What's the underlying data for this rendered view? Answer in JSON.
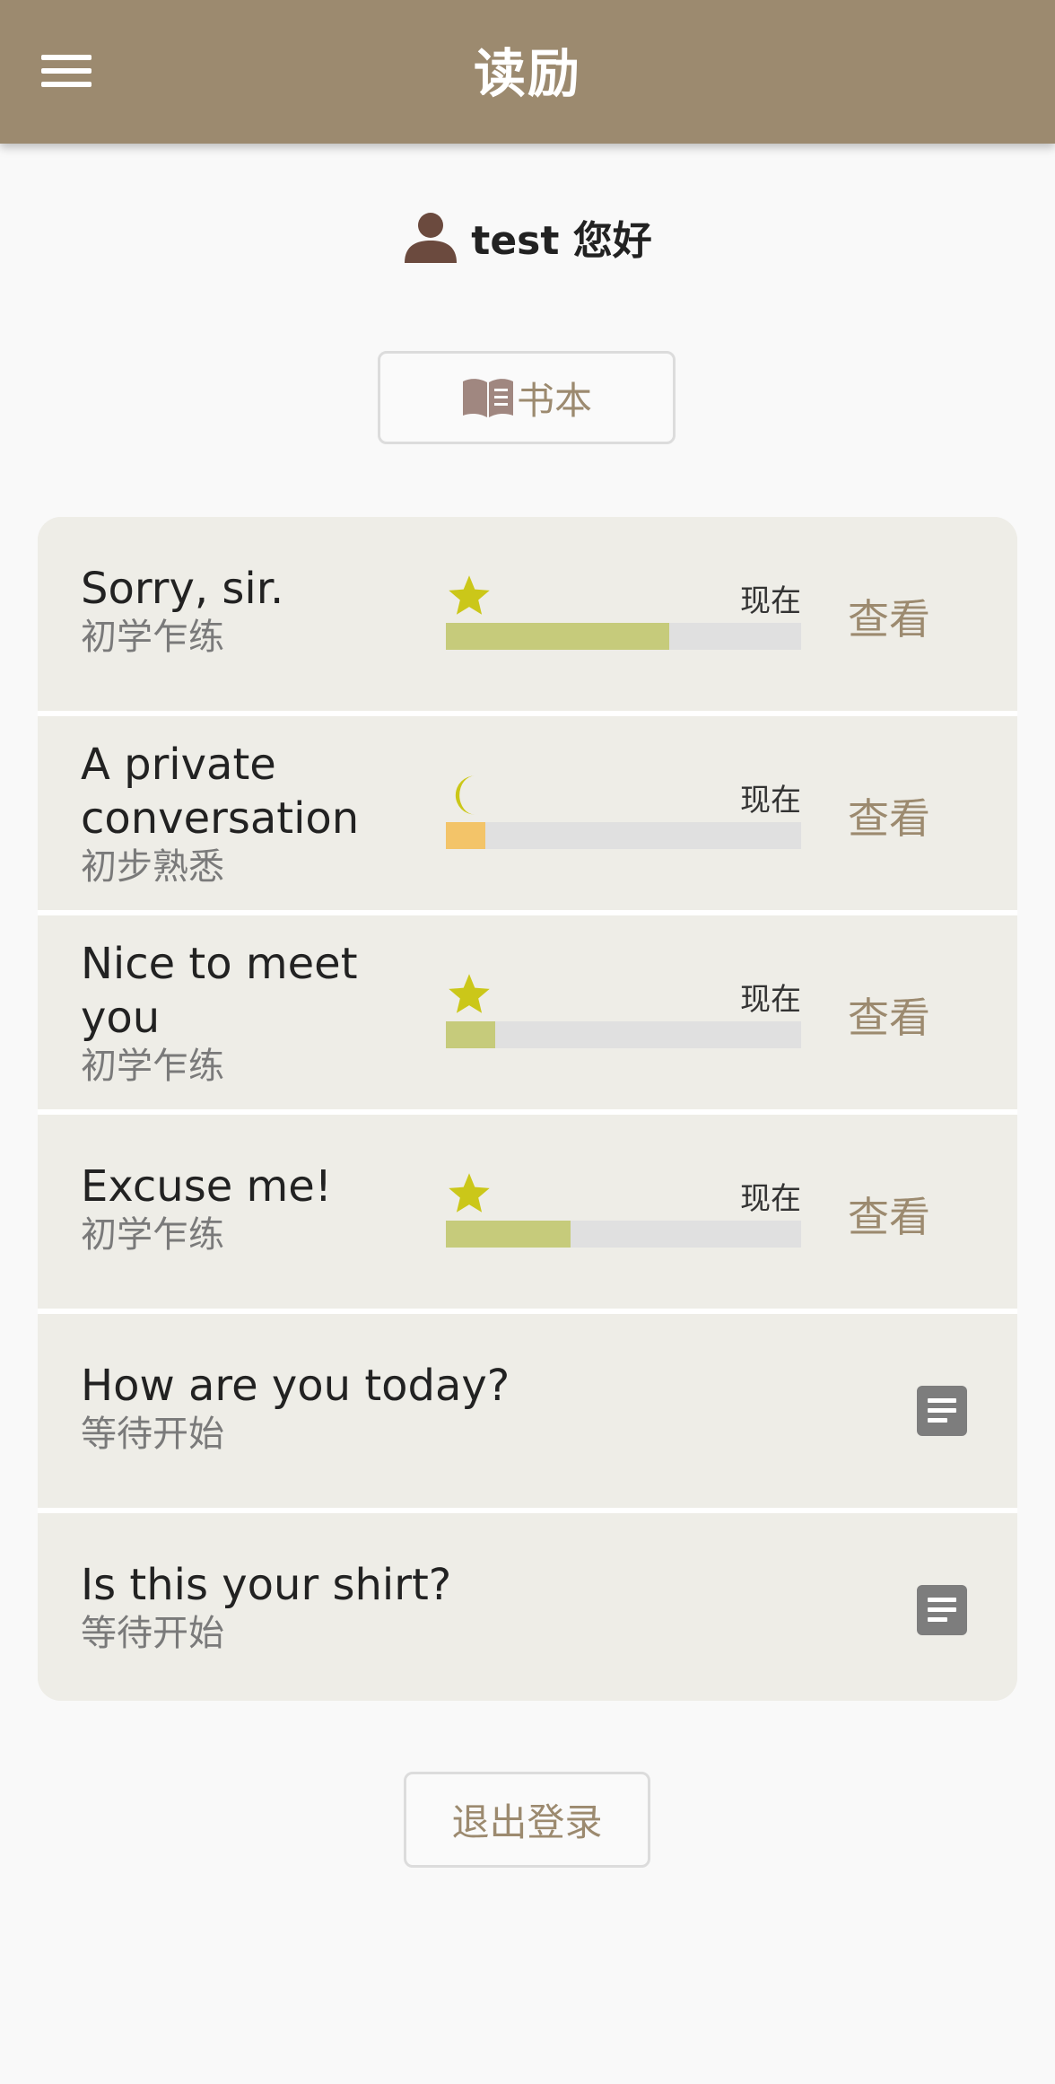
{
  "app": {
    "title": "读励",
    "brand_color": "#9c8a6f"
  },
  "header": {
    "menu_icon": "hamburger-menu-icon"
  },
  "user": {
    "icon": "person-icon",
    "greeting": "test 您好"
  },
  "books_button": {
    "icon": "open-book-icon",
    "label": "书本"
  },
  "lessons": [
    {
      "title": "Sorry, sir.",
      "status": "初学乍练",
      "rating_icon": "star-icon",
      "now_label": "现在",
      "progress": 0.63,
      "progress_color": "#c6cb7b",
      "action": "查看"
    },
    {
      "title": "A private conversation",
      "status": "初步熟悉",
      "rating_icon": "crescent-moon-icon",
      "now_label": "现在",
      "progress": 0.11,
      "progress_color": "#f3c469",
      "action": "查看"
    },
    {
      "title": "Nice to meet you",
      "status": "初学乍练",
      "rating_icon": "star-icon",
      "now_label": "现在",
      "progress": 0.14,
      "progress_color": "#c6cb7b",
      "action": "查看"
    },
    {
      "title": "Excuse me!",
      "status": "初学乍练",
      "rating_icon": "star-icon",
      "now_label": "现在",
      "progress": 0.35,
      "progress_color": "#c6cb7b",
      "action": "查看"
    },
    {
      "title": "How are you today?",
      "status": "等待开始",
      "action_icon": "document-icon"
    },
    {
      "title": "Is this your shirt?",
      "status": "等待开始",
      "action_icon": "document-icon"
    }
  ],
  "logout_button": {
    "label": "退出登录"
  },
  "colors": {
    "icon_yellow": "#cbc719",
    "avatar_brown": "#6b4a3e",
    "book_icon": "#a08780"
  }
}
